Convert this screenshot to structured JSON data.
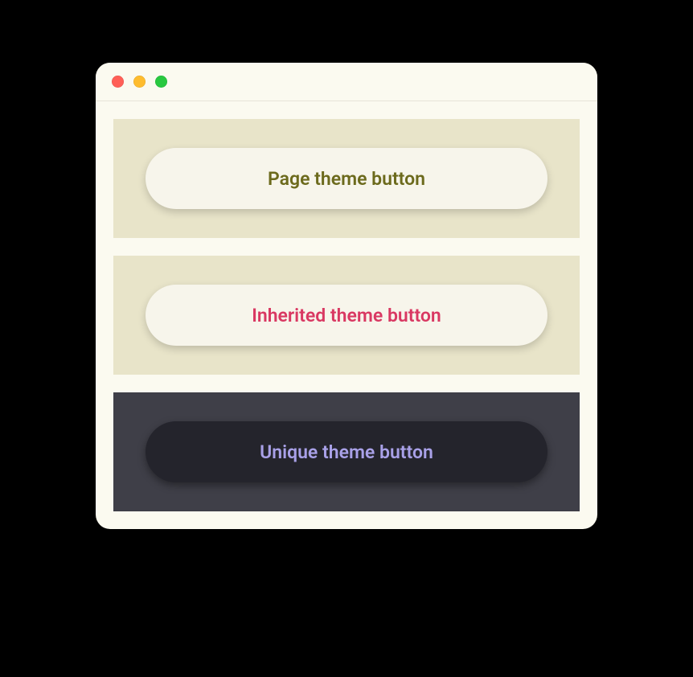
{
  "panels": [
    {
      "button_label": "Page theme button",
      "panel_bg": "#e8e4c9",
      "button_bg": "#f7f5eb",
      "button_text_color": "#6c6a1c"
    },
    {
      "button_label": "Inherited theme button",
      "panel_bg": "#e8e4c9",
      "button_bg": "#f7f5eb",
      "button_text_color": "#d93862"
    },
    {
      "button_label": "Unique theme button",
      "panel_bg": "#3f3f48",
      "button_bg": "#24242c",
      "button_text_color": "#a9a1e8"
    }
  ]
}
